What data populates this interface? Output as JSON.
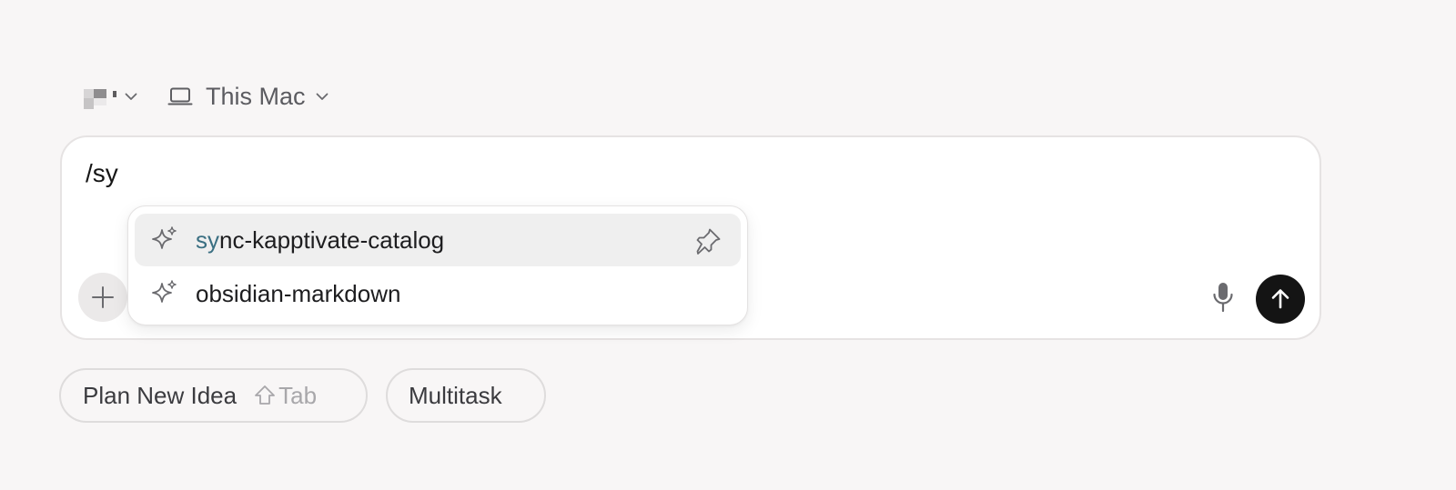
{
  "project_selector": {
    "avatar_icon": "pixelated-project-avatar",
    "chevron_icon": "chevron-down-icon"
  },
  "environment_selector": {
    "icon": "laptop-icon",
    "label": "This Mac",
    "chevron_icon": "chevron-down-icon"
  },
  "composer": {
    "input_value": "/sy",
    "attach_icon": "plus-icon",
    "mic_icon": "microphone-icon",
    "send_icon": "arrow-up-icon"
  },
  "autocomplete": {
    "items": [
      {
        "icon": "sparkle-icon",
        "match": "sy",
        "rest": "nc-kapptivate-catalog",
        "highlighted": true,
        "pin_icon": "pin-icon"
      },
      {
        "icon": "sparkle-icon",
        "label": "obsidian-markdown",
        "highlighted": false
      }
    ]
  },
  "quick_actions": {
    "plan": {
      "label": "Plan New Idea",
      "shortcut_icon": "shift-icon",
      "shortcut_key": "Tab"
    },
    "multitask": {
      "label": "Multitask"
    }
  },
  "colors": {
    "background": "#f8f6f6",
    "match_highlight": "#3a6f82",
    "send_button": "#141414",
    "active_row": "#efefef"
  }
}
